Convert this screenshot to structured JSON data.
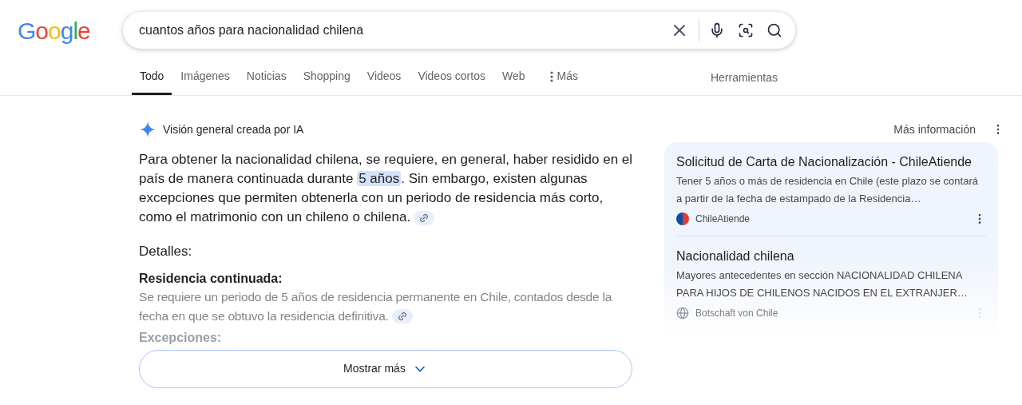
{
  "logo": "Google",
  "search": {
    "value": "cuantos años para nacionalidad chilena"
  },
  "tabs": [
    {
      "label": "Todo",
      "selected": true
    },
    {
      "label": "Imágenes",
      "selected": false
    },
    {
      "label": "Noticias",
      "selected": false
    },
    {
      "label": "Shopping",
      "selected": false
    },
    {
      "label": "Videos",
      "selected": false
    },
    {
      "label": "Videos cortos",
      "selected": false
    },
    {
      "label": "Web",
      "selected": false
    },
    {
      "label": "Más",
      "selected": false,
      "kind": "more"
    }
  ],
  "tools": "Herramientas",
  "overview": {
    "title": "Visión general creada por IA",
    "more_info": "Más información",
    "summary": [
      {
        "text": "Para obtener la nacionalidad chilena, se requiere, en general, haber residido en el país de manera continuada durante ",
        "highlighted": false
      },
      {
        "text": "5 años",
        "highlighted": true
      },
      {
        "text": ". Sin embargo, existen algunas excepciones que permiten obtenerla con un periodo de residencia más corto, como el matrimonio con un chileno o chilena.",
        "highlighted": false
      }
    ],
    "details_heading": "Detalles:",
    "sections": [
      {
        "heading": "Residencia continuada:",
        "text": "Se requiere un periodo de 5 años de residencia permanente en Chile, contados desde la fecha en que se obtuvo la residencia definitiva."
      },
      {
        "heading": "Excepciones:"
      }
    ],
    "show_more": "Mostrar más",
    "sources": [
      {
        "title": "Solicitud de Carta de Nacionalización - ChileAtiende",
        "snippet": "Tener 5 años o más de residencia en Chile (este plazo se contará a partir de la fecha de estampado de la Residencia…",
        "site": "ChileAtiende",
        "kind": "flag"
      },
      {
        "title": "Nacionalidad chilena",
        "snippet": "Mayores antecedentes en sección NACIONALIDAD CHILENA PARA HIJOS DE CHILENOS NACIDOS EN EL EXTRANJER…",
        "site": "Botschaft von Chile",
        "kind": "globe"
      }
    ]
  }
}
